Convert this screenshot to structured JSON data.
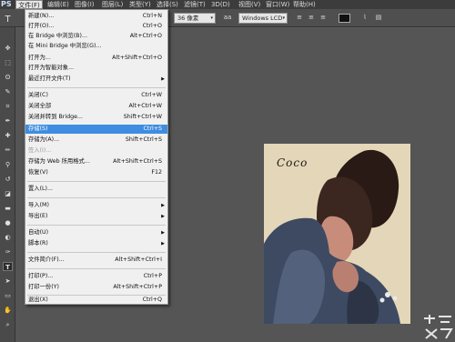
{
  "app": {
    "logo": "PS"
  },
  "menubar": {
    "items": [
      "文件(F)",
      "编辑(E)",
      "图像(I)",
      "图层(L)",
      "类型(Y)",
      "选择(S)",
      "滤镜(T)",
      "3D(D)",
      "视图(V)",
      "窗口(W)",
      "帮助(H)"
    ]
  },
  "options": {
    "font_size": "36 像素",
    "antialias": "Windows LCD",
    "tool_glyph": "T"
  },
  "canvas": {
    "text": "Coco"
  },
  "file_menu": {
    "items": [
      {
        "label": "新建(N)...",
        "shortcut": "Ctrl+N"
      },
      {
        "label": "打开(O)...",
        "shortcut": "Ctrl+O"
      },
      {
        "label": "在 Bridge 中浏览(B)...",
        "shortcut": "Alt+Ctrl+O"
      },
      {
        "label": "在 Mini Bridge 中浏览(G)...",
        "shortcut": ""
      },
      {
        "label": "打开为...",
        "shortcut": "Alt+Shift+Ctrl+O"
      },
      {
        "label": "打开为智能对象...",
        "shortcut": ""
      },
      {
        "label": "最近打开文件(T)",
        "shortcut": ""
      },
      {
        "label": "关闭(C)",
        "shortcut": "Ctrl+W"
      },
      {
        "label": "关闭全部",
        "shortcut": "Alt+Ctrl+W"
      },
      {
        "label": "关闭并转到 Bridge...",
        "shortcut": "Shift+Ctrl+W"
      },
      {
        "label": "存储(S)",
        "shortcut": "Ctrl+S"
      },
      {
        "label": "存储为(A)...",
        "shortcut": "Shift+Ctrl+S"
      },
      {
        "label": "签入(I)...",
        "shortcut": ""
      },
      {
        "label": "存储为 Web 所用格式...",
        "shortcut": "Alt+Shift+Ctrl+S"
      },
      {
        "label": "恢复(V)",
        "shortcut": "F12"
      },
      {
        "label": "置入(L)...",
        "shortcut": ""
      },
      {
        "label": "导入(M)",
        "shortcut": ""
      },
      {
        "label": "导出(E)",
        "shortcut": ""
      },
      {
        "label": "自动(U)",
        "shortcut": ""
      },
      {
        "label": "脚本(R)",
        "shortcut": ""
      },
      {
        "label": "文件简介(F)...",
        "shortcut": "Alt+Shift+Ctrl+I"
      },
      {
        "label": "打印(P)...",
        "shortcut": "Ctrl+P"
      },
      {
        "label": "打印一份(Y)",
        "shortcut": "Alt+Shift+Ctrl+P"
      },
      {
        "label": "退出(X)",
        "shortcut": "Ctrl+Q"
      }
    ]
  },
  "colors": {
    "highlight": "#3e8de0",
    "foreground": "#2e7ec8"
  }
}
